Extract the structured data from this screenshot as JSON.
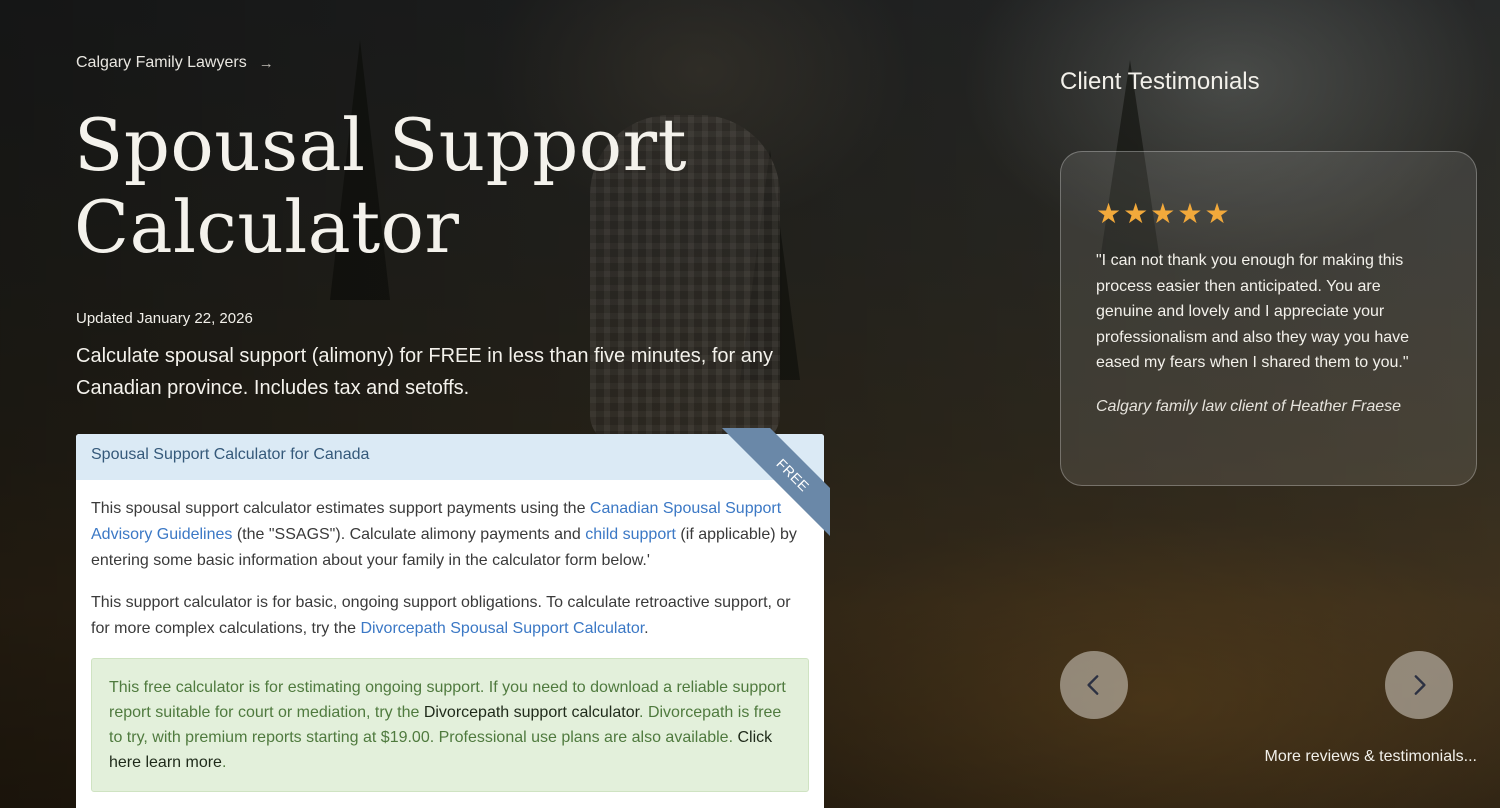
{
  "breadcrumb": {
    "label": "Calgary Family Lawyers",
    "arrow": "→"
  },
  "page": {
    "title_line1": "Spousal Support",
    "title_line2": "Calculator",
    "updated": "Updated January 22, 2026",
    "intro_line1": "Calculate spousal support (alimony) for FREE in less than five minutes, for any",
    "intro_line2": "Canadian province. Includes tax and setoffs."
  },
  "card": {
    "header": "Spousal Support Calculator for Canada",
    "ribbon": "FREE",
    "p1_text1": "This spousal support calculator estimates support payments using the ",
    "p1_link1": "Canadian Spousal Support Advisory Guidelines",
    "p1_text2": " (the \"SSAGS\"). Calculate alimony payments and ",
    "p1_link2": "child support",
    "p1_text3": " (if applicable) by entering some basic information about your family in the calculator form below.'",
    "p2_text1": "This support calculator is for basic, ongoing support obligations. To calculate retroactive support, or for more complex calculations, try the ",
    "p2_link": "Divorcepath Spousal Support Calculator",
    "p2_text2": ".",
    "notice_text1": "This free calculator is for estimating ongoing support. If you need to download a reliable support report suitable for court or mediation, try the ",
    "notice_strong1": "Divorcepath support calculator",
    "notice_text2": ". Divorcepath is free to try, with premium reports starting at $19.00. Professional use plans are also available. ",
    "notice_strong2": "Click here learn more",
    "notice_text3": "."
  },
  "testimonials": {
    "title": "Client Testimonials",
    "stars": [
      "★",
      "★",
      "★",
      "★",
      "★"
    ],
    "rating": 5,
    "star_color": "#f2a93b",
    "quote": "\"I can not thank you enough for making this process easier then anticipated. You are genuine and lovely and I appreciate your professionalism and also they way you have eased my fears when I shared them to you.\"",
    "attribution": "Calgary family law client of Heather Fraese",
    "more_link": "More reviews & testimonials..."
  },
  "icons": {
    "prev": "chevron-left-icon",
    "next": "chevron-right-icon"
  }
}
